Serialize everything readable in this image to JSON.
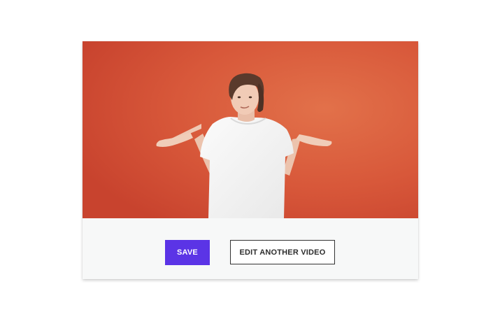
{
  "colors": {
    "accent": "#5b34e6",
    "video_background": "#d9573b"
  },
  "video": {
    "preview_icon": "person-shrugging-video-frame"
  },
  "actions": {
    "save_label": "SAVE",
    "edit_another_label": "EDIT ANOTHER VIDEO"
  }
}
